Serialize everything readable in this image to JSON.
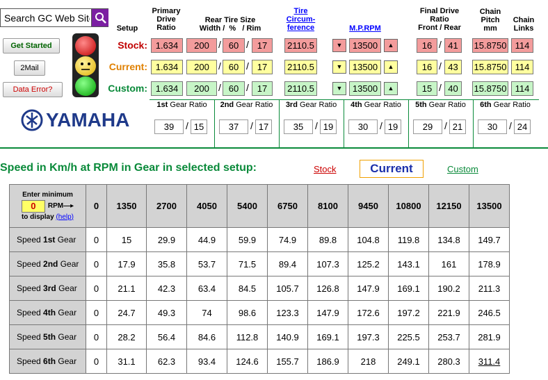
{
  "search": {
    "value": "Search GC Web Site"
  },
  "headers": {
    "setup": "Setup",
    "primary_ratio": [
      "Primary",
      "Drive",
      "Ratio"
    ],
    "rear_tire": [
      "Rear Tire Size",
      "Width /  %   / Rim"
    ],
    "tire_circ": [
      "Tire",
      "Circum-",
      "ference"
    ],
    "mprpm": "M.P.RPM",
    "final_drive": [
      "Final Drive",
      "Ratio",
      "Front / Rear"
    ],
    "chain_pitch": [
      "Chain",
      "Pitch",
      "mm"
    ],
    "chain_links": [
      "Chain",
      "Links"
    ]
  },
  "buttons": {
    "get_started": "Get Started",
    "email": "2Mail",
    "data_error": "Data Error?"
  },
  "setups": [
    {
      "label": "Stock:",
      "color": "#c00000",
      "primary": "1.634",
      "width": "200",
      "pct": "60",
      "rim": "17",
      "circ": "2110.5",
      "rpm": "13500",
      "front": "16",
      "rear": "41",
      "pitch": "15.8750",
      "links": "114"
    },
    {
      "label": "Current:",
      "color": "#e08000",
      "primary": "1.634",
      "width": "200",
      "pct": "60",
      "rim": "17",
      "circ": "2110.5",
      "rpm": "13500",
      "front": "16",
      "rear": "43",
      "pitch": "15.8750",
      "links": "114"
    },
    {
      "label": "Custom:",
      "color": "#0a8a3a",
      "primary": "1.634",
      "width": "200",
      "pct": "60",
      "rim": "17",
      "circ": "2110.5",
      "rpm": "13500",
      "front": "15",
      "rear": "40",
      "pitch": "15.8750",
      "links": "114"
    }
  ],
  "separator": "/",
  "arrows": {
    "down": "▼",
    "up": "▲"
  },
  "gear_ratios": [
    {
      "num": "1st",
      "rest": " Gear Ratio",
      "a": "39",
      "b": "15"
    },
    {
      "num": "2nd",
      "rest": " Gear Ratio",
      "a": "37",
      "b": "17"
    },
    {
      "num": "3rd",
      "rest": " Gear Ratio",
      "a": "35",
      "b": "19"
    },
    {
      "num": "4th",
      "rest": " Gear Ratio",
      "a": "30",
      "b": "19"
    },
    {
      "num": "5th",
      "rest": " Gear Ratio",
      "a": "29",
      "b": "21"
    },
    {
      "num": "6th",
      "rest": " Gear Ratio",
      "a": "30",
      "b": "24"
    }
  ],
  "brand": "YAMAHA",
  "speed_section": {
    "title": "Speed in Km/h at RPM in Gear in selected setup:",
    "stock_link": "Stock",
    "current": "Current",
    "custom_link": "Custom"
  },
  "table": {
    "corner": {
      "line1": "Enter minimum",
      "min_value": "0",
      "rpm": "RPM—▸",
      "line3": "to display",
      "help": "(help)"
    },
    "rpms": [
      "0",
      "1350",
      "2700",
      "4050",
      "5400",
      "6750",
      "8100",
      "9450",
      "10800",
      "12150",
      "13500"
    ],
    "rows": [
      {
        "pre": "Speed ",
        "gear": "1st",
        "post": " Gear",
        "values": [
          "0",
          "15",
          "29.9",
          "44.9",
          "59.9",
          "74.9",
          "89.8",
          "104.8",
          "119.8",
          "134.8",
          "149.7"
        ]
      },
      {
        "pre": "Speed ",
        "gear": "2nd",
        "post": " Gear",
        "values": [
          "0",
          "17.9",
          "35.8",
          "53.7",
          "71.5",
          "89.4",
          "107.3",
          "125.2",
          "143.1",
          "161",
          "178.9"
        ]
      },
      {
        "pre": "Speed ",
        "gear": "3rd",
        "post": " Gear",
        "values": [
          "0",
          "21.1",
          "42.3",
          "63.4",
          "84.5",
          "105.7",
          "126.8",
          "147.9",
          "169.1",
          "190.2",
          "211.3"
        ]
      },
      {
        "pre": "Speed ",
        "gear": "4th",
        "post": " Gear",
        "values": [
          "0",
          "24.7",
          "49.3",
          "74",
          "98.6",
          "123.3",
          "147.9",
          "172.6",
          "197.2",
          "221.9",
          "246.5"
        ]
      },
      {
        "pre": "Speed ",
        "gear": "5th",
        "post": " Gear",
        "values": [
          "0",
          "28.2",
          "56.4",
          "84.6",
          "112.8",
          "140.9",
          "169.1",
          "197.3",
          "225.5",
          "253.7",
          "281.9"
        ]
      },
      {
        "pre": "Speed ",
        "gear": "6th",
        "post": " Gear",
        "values": [
          "0",
          "31.1",
          "62.3",
          "93.4",
          "124.6",
          "155.7",
          "186.9",
          "218",
          "249.1",
          "280.3",
          "311.4"
        ]
      }
    ]
  },
  "colors": {
    "green": "#0a8a3a",
    "red_field": "#f39c9c",
    "yellow_field": "#ffff9f",
    "green_field": "#c7f5c7",
    "search_btn": "#7b1fa2"
  }
}
